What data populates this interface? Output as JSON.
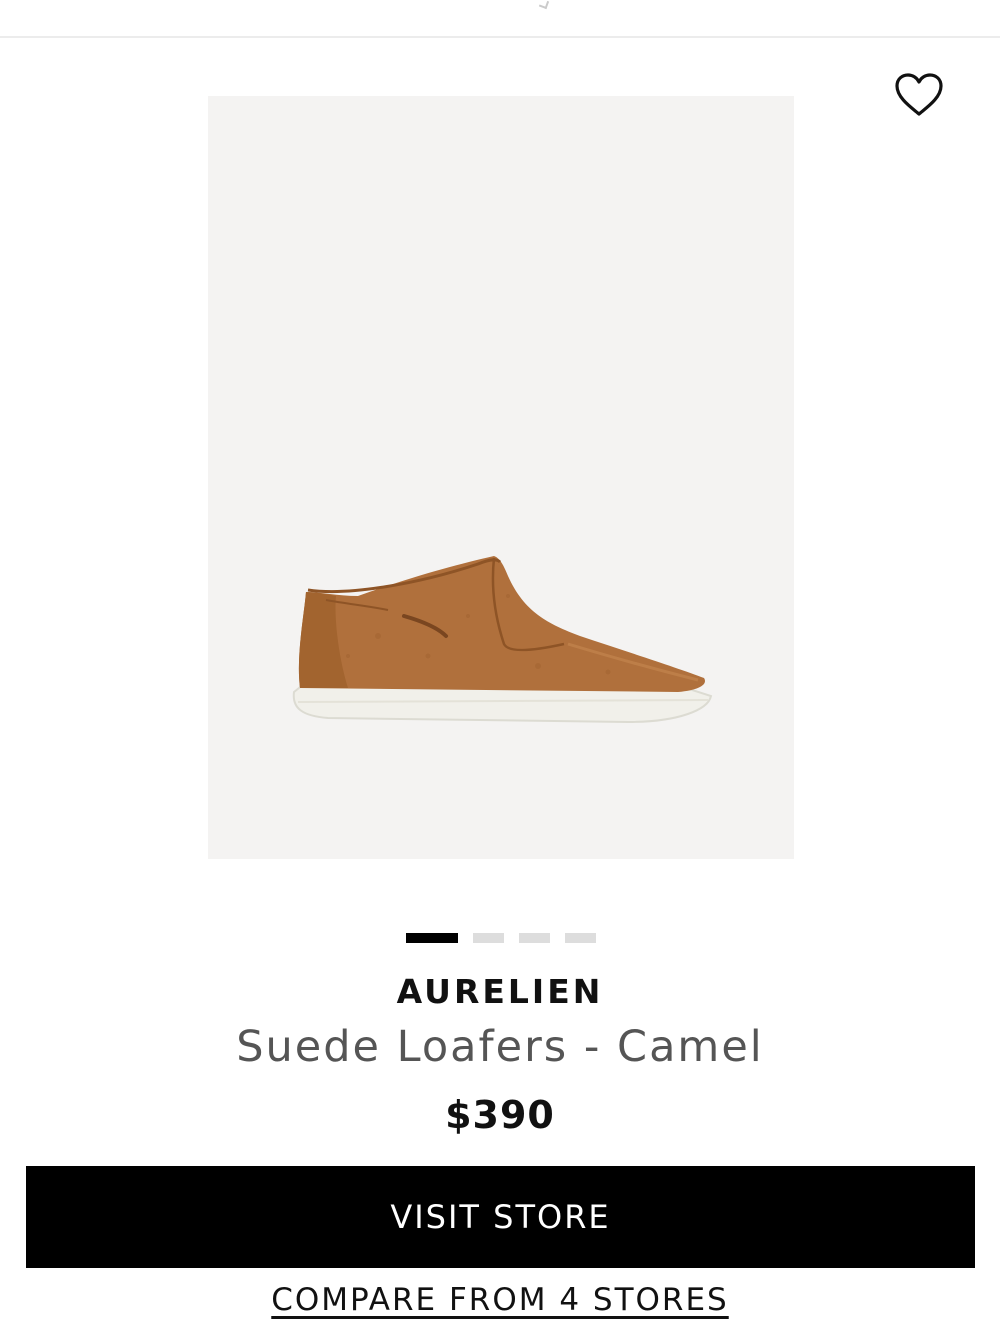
{
  "product": {
    "brand": "AURELIEN",
    "name": "Suede Loafers - Camel",
    "price": "$390"
  },
  "gallery": {
    "total_images": 4,
    "active_index": 0
  },
  "actions": {
    "visit_store_label": "VISIT STORE",
    "compare_label": "COMPARE FROM 4 STORES"
  },
  "icons": {
    "wishlist": "heart-outline-icon"
  },
  "colors": {
    "primary_button": "#000000",
    "primary_button_text": "#ffffff",
    "image_background": "#f4f3f2",
    "shoe_suede": "#b0703c",
    "sole": "#f1f0ea"
  }
}
